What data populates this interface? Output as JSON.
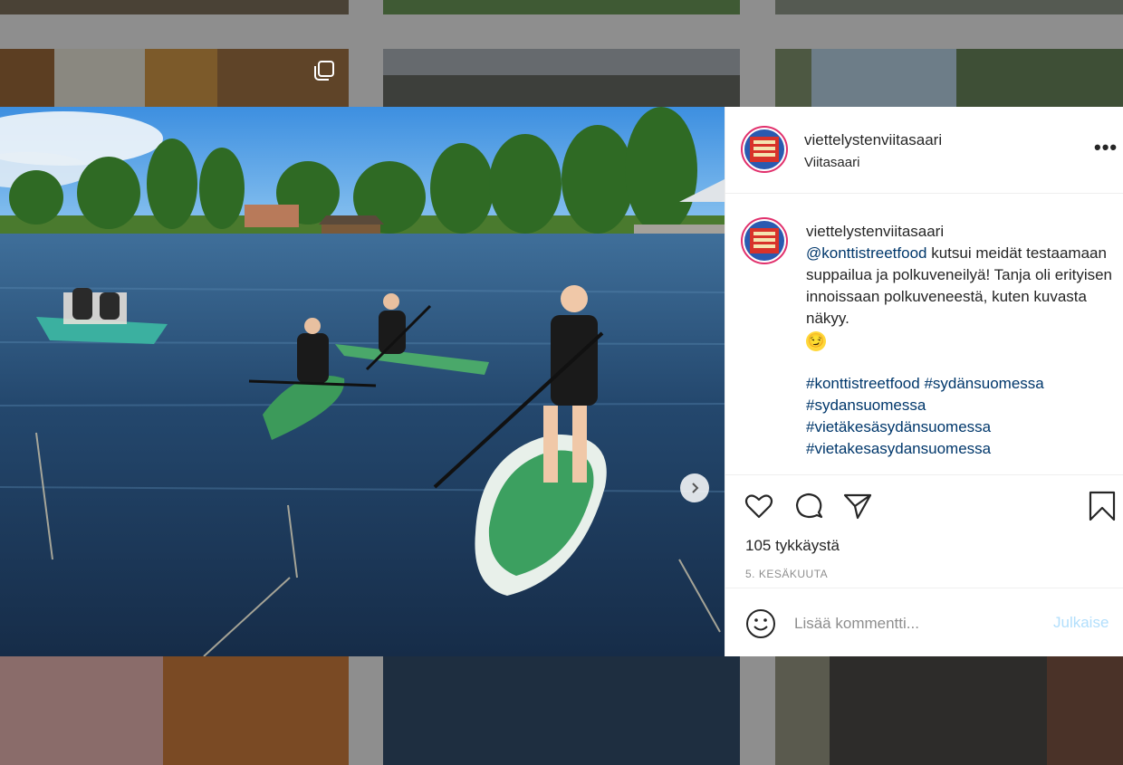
{
  "post": {
    "username": "viettelystenviitasaari",
    "location": "Viitasaari",
    "more_label": "•••",
    "caption": {
      "username": "viettelystenviitasaari",
      "mention": "@konttistreetfood",
      "text": " kutsui meidät testaamaan suppailua ja polkuveneilyä! Tanja oli erityisen innoissaan polkuveneestä, kuten kuvasta näkyy.",
      "emoji": "😏",
      "hashtags": [
        "#konttistreetfood",
        "#sydänsuomessa",
        "#sydansuomessa",
        "#vietäkesäsydänsuomessa",
        "#vietakesasydansuomessa"
      ]
    },
    "likes": "105 tykkäystä",
    "date": "5. KESÄKUUTA",
    "carousel": {
      "count": 3,
      "active": 0
    }
  },
  "comment": {
    "placeholder": "Lisää kommentti...",
    "post_label": "Julkaise"
  },
  "colors": {
    "accent_link": "#00376b",
    "post_disabled": "#b2dffc",
    "avatar_ring": "#e1306c"
  },
  "icons": [
    "heart-icon",
    "comment-icon",
    "share-icon",
    "bookmark-icon",
    "emoji-icon",
    "user-tag-icon",
    "chevron-right-icon",
    "multi-image-icon"
  ]
}
